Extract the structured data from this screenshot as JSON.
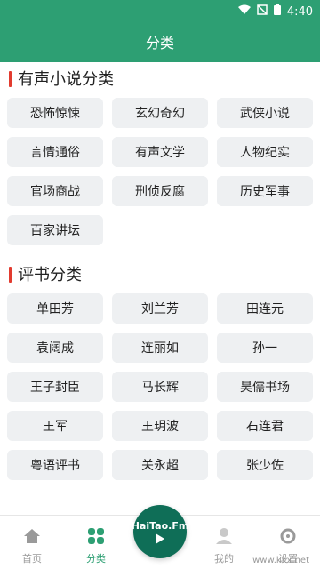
{
  "status_bar": {
    "time": "4:40"
  },
  "header": {
    "title": "分类"
  },
  "sections": [
    {
      "title": "有声小说分类",
      "items": [
        "恐怖惊悚",
        "玄幻奇幻",
        "武侠小说",
        "言情通俗",
        "有声文学",
        "人物纪实",
        "官场商战",
        "刑侦反腐",
        "历史军事",
        "百家讲坛"
      ]
    },
    {
      "title": "评书分类",
      "items": [
        "单田芳",
        "刘兰芳",
        "田连元",
        "袁阔成",
        "连丽如",
        "孙一",
        "王子封臣",
        "马长辉",
        "昊儒书场",
        "王军",
        "王玥波",
        "石连君",
        "粤语评书",
        "关永超",
        "张少佐"
      ]
    }
  ],
  "bottom_nav": {
    "home": "首页",
    "category": "分类",
    "center_logo": "HaiTao.Fm",
    "mine": "我的",
    "settings": "设置"
  },
  "watermark": "www.kkx.net",
  "colors": {
    "primary": "#2d9f73",
    "accent_red": "#e23b2f"
  }
}
